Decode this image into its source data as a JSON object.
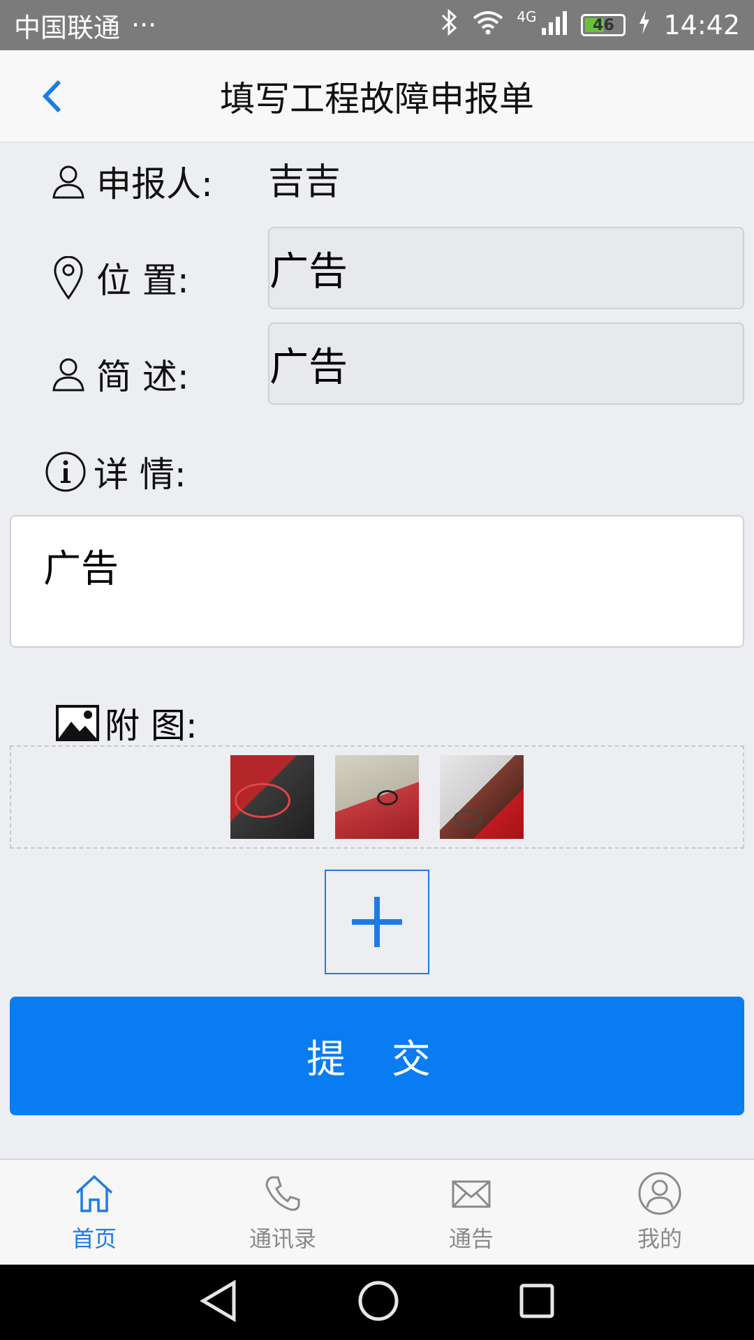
{
  "status": {
    "carrier": "中国联通",
    "dots": "···",
    "network": "4G",
    "battery": "46",
    "time": "14:42"
  },
  "header": {
    "title": "填写工程故障申报单"
  },
  "form": {
    "reporter_label": "申报人:",
    "reporter_value": "吉吉",
    "location_label": "位 置:",
    "location_value": "广告",
    "summary_label": "简 述:",
    "summary_value": "广告",
    "details_label": "详 情:",
    "details_value": "广告",
    "attachments_label": "附 图:"
  },
  "submit_label": "提 交",
  "tabs": [
    {
      "label": "首页",
      "icon": "home-icon",
      "active": true
    },
    {
      "label": "通讯录",
      "icon": "phone-icon",
      "active": false
    },
    {
      "label": "通告",
      "icon": "mail-icon",
      "active": false
    },
    {
      "label": "我的",
      "icon": "user-circle-icon",
      "active": false
    }
  ],
  "colors": {
    "accent": "#0a7cf2",
    "background": "#eceef2",
    "statusbar": "#7b7b7b"
  }
}
